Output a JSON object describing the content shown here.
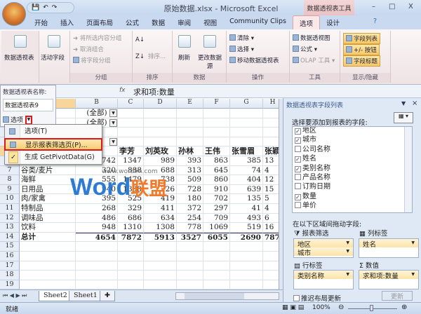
{
  "window": {
    "title": "原始数据.xlsx - Microsoft Excel",
    "tool_tab": "数据透视表工具",
    "minimize": "–",
    "maximize": "□",
    "close": "X"
  },
  "tabs": [
    "开始",
    "插入",
    "页面布局",
    "公式",
    "数据",
    "审阅",
    "视图",
    "Community Clips",
    "选项",
    "设计"
  ],
  "active_tab": "选项",
  "ribbon": {
    "pivot_table": "数据透视表",
    "active_field": "活动字段",
    "group": {
      "label": "分组",
      "items": [
        "将所选内容分组",
        "取消组合",
        "将字段分组"
      ]
    },
    "sort": {
      "label": "排序",
      "sort_btn": "排序..."
    },
    "data": {
      "label": "数据",
      "refresh": "刷新",
      "change_source": "更改数据源"
    },
    "actions": {
      "label": "操作",
      "items": [
        "清除",
        "选择",
        "移动数据透视表"
      ]
    },
    "tools": {
      "label": "工具",
      "items": [
        "数据透视图",
        "公式",
        "OLAP 工具"
      ]
    },
    "show_hide": {
      "label": "显示/隐藏",
      "items": [
        "字段列表",
        "+/- 按钮",
        "字段标题"
      ]
    }
  },
  "name_panel": {
    "label": "数据透视表名称:",
    "name": "数据透视表9",
    "options": "选项"
  },
  "formula": {
    "fx": "fx",
    "value": "求和项:数量"
  },
  "columns": [
    "B",
    "C",
    "D",
    "E",
    "F",
    "G",
    "H"
  ],
  "filters": [
    "(全部)",
    "(全部)"
  ],
  "header_row": [
    "李芳",
    "刘英玫",
    "孙林",
    "王伟",
    "张雪眉",
    "张颖"
  ],
  "rows": [
    {
      "n": "6",
      "label": "",
      "values": [
        "742",
        "1347",
        "989",
        "393",
        "863",
        "385",
        "13"
      ]
    },
    {
      "n": "7",
      "label": "谷类/麦片",
      "values": [
        "320",
        "888",
        "688",
        "313",
        "645",
        "74",
        "4"
      ]
    },
    {
      "n": "8",
      "label": "海鲜",
      "values": [
        "555",
        "1479",
        "738",
        "509",
        "860",
        "404",
        "12"
      ]
    },
    {
      "n": "9",
      "label": "日用品",
      "values": [
        "940",
        "1308",
        "726",
        "728",
        "910",
        "639",
        "15"
      ]
    },
    {
      "n": "10",
      "label": "肉/家禽",
      "values": [
        "395",
        "525",
        "419",
        "180",
        "702",
        "135",
        "5"
      ]
    },
    {
      "n": "11",
      "label": "特制品",
      "values": [
        "268",
        "329",
        "411",
        "372",
        "297",
        "41",
        "4"
      ]
    },
    {
      "n": "12",
      "label": "调味品",
      "values": [
        "486",
        "686",
        "634",
        "254",
        "709",
        "493",
        "6"
      ]
    },
    {
      "n": "13",
      "label": "饮料",
      "values": [
        "948",
        "1310",
        "1308",
        "778",
        "1069",
        "519",
        "16"
      ]
    },
    {
      "n": "14",
      "label": "总计",
      "values": [
        "4654",
        "7872",
        "5913",
        "3527",
        "6055",
        "2690",
        "787"
      ]
    }
  ],
  "empty_rows": [
    "15",
    "16",
    "17",
    "18",
    "19"
  ],
  "context_menu": [
    {
      "label": "选项(T)"
    },
    {
      "label": "显示报表筛选页(P)..."
    },
    {
      "label": "生成 GetPivotData(G)",
      "checked": true
    }
  ],
  "watermark": {
    "url": "www.wordlm.com",
    "brand_word": "Word",
    "brand_cn": "联盟"
  },
  "field_list": {
    "title": "数据透视表字段列表",
    "choose_label": "选择要添加到报表的字段:",
    "fields": [
      {
        "name": "地区",
        "checked": true
      },
      {
        "name": "城市",
        "checked": true
      },
      {
        "name": "公司名称",
        "checked": false
      },
      {
        "name": "姓名",
        "checked": true
      },
      {
        "name": "类别名称",
        "checked": true
      },
      {
        "name": "产品名称",
        "checked": false
      },
      {
        "name": "订购日期",
        "checked": false
      },
      {
        "name": "数量",
        "checked": true
      },
      {
        "name": "单价",
        "checked": false
      }
    ],
    "drag_label": "在以下区域间拖动字段:",
    "report_filter": "报表筛选",
    "filter_items": [
      "地区",
      "城市"
    ],
    "column_labels": "列标签",
    "column_items": [
      "姓名"
    ],
    "row_labels": "行标签",
    "row_items": [
      "类别名称"
    ],
    "values": "数值",
    "value_items": [
      "求和项:数量"
    ],
    "defer": "推迟布局更新",
    "update": "更新"
  },
  "sheets": [
    "Sheet2",
    "Sheet1"
  ],
  "active_sheet": "Sheet2",
  "status": {
    "ready": "就绪",
    "zoom": "100%"
  },
  "colors": {
    "accent_red": "#e0161a",
    "highlight": "#f8c768",
    "ribbon_bg": "#f4ecec"
  }
}
